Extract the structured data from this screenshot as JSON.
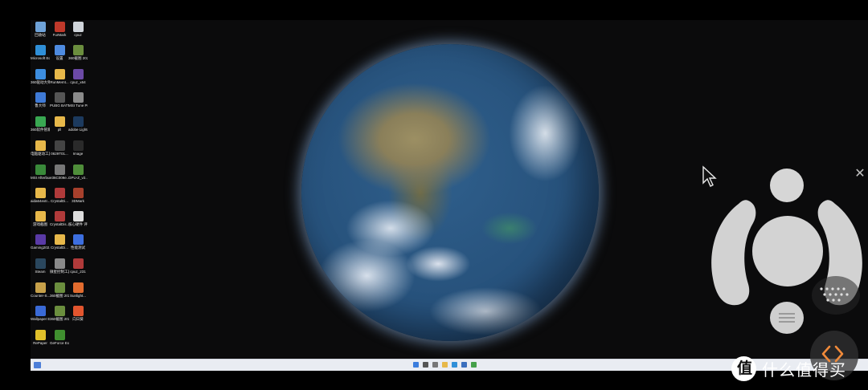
{
  "desktop": {
    "icons": [
      {
        "label": "回收站",
        "color": "#6fa3d9",
        "icon": "recycle-bin-icon"
      },
      {
        "label": "FurMark",
        "color": "#c0392b",
        "icon": "furmark-icon"
      },
      {
        "label": "cpuz",
        "color": "#cfd4da",
        "icon": "file-icon"
      },
      {
        "label": "Microsoft Edge",
        "color": "#2f8fd8",
        "icon": "edge-icon"
      },
      {
        "label": "设置",
        "color": "#4e8be0",
        "icon": "settings-app-icon"
      },
      {
        "label": "360截图 20220412...",
        "color": "#6b8e3e",
        "icon": "image-icon"
      },
      {
        "label": "360驱动大师",
        "color": "#3d8ee0",
        "icon": "driver-master-icon"
      },
      {
        "label": "RunMemt...",
        "color": "#e7b84a",
        "icon": "folder-icon"
      },
      {
        "label": "cpuz_x64",
        "color": "#6c4aa6",
        "icon": "cpuz-icon"
      },
      {
        "label": "鲁大师",
        "color": "#3f7ad6",
        "icon": "ludashi-icon"
      },
      {
        "label": "PUBG BATTLEGR...",
        "color": "#555",
        "icon": "pubg-icon"
      },
      {
        "label": "MSI Tune Pro",
        "color": "#8a8a8a",
        "icon": "msi-icon"
      },
      {
        "label": "360软件管家",
        "color": "#39a852",
        "icon": "software-manager-icon"
      },
      {
        "label": "pll",
        "color": "#e7b84a",
        "icon": "folder-icon"
      },
      {
        "label": "adobe Lightroo...",
        "color": "#1c3a5e",
        "icon": "lightroom-icon"
      },
      {
        "label": "电脑驱动工具2021",
        "color": "#e7b84a",
        "icon": "folder-icon"
      },
      {
        "label": "0629T01...",
        "color": "#444",
        "icon": "image-icon"
      },
      {
        "label": "Image",
        "color": "#2a2a2a",
        "icon": "image-icon"
      },
      {
        "label": "MSI Afterburner",
        "color": "#3a8a3a",
        "icon": "afterburner-icon"
      },
      {
        "label": "e36C009e...",
        "color": "#777",
        "icon": "file-icon"
      },
      {
        "label": "GPU-Z_v2...",
        "color": "#4f8e3a",
        "icon": "gpuz-icon"
      },
      {
        "label": "aida64extr...",
        "color": "#e7b84a",
        "icon": "folder-icon"
      },
      {
        "label": "CrystalDi...",
        "color": "#b03a3a",
        "icon": "winrar-icon"
      },
      {
        "label": "3DMark",
        "color": "#a7402c",
        "icon": "3dmark-icon"
      },
      {
        "label": "游戏截图",
        "color": "#e7b84a",
        "icon": "folder-icon"
      },
      {
        "label": "CrystalDis...",
        "color": "#b03a3a",
        "icon": "winrar-icon"
      },
      {
        "label": "核心硬件 评测",
        "color": "#dddddd",
        "icon": "file-icon"
      },
      {
        "label": "Gaming202...",
        "color": "#5a3aa6",
        "icon": "gaming-icon"
      },
      {
        "label": "CrystalDi...",
        "color": "#e7b84a",
        "icon": "folder-icon"
      },
      {
        "label": "性能测试",
        "color": "#3d6fe0",
        "icon": "benchmark-icon"
      },
      {
        "label": "Steam",
        "color": "#2a475e",
        "icon": "steam-icon"
      },
      {
        "label": "微星控制工具 MSI Tune...",
        "color": "#8a8a8a",
        "icon": "msi-icon"
      },
      {
        "label": "cpuz_231",
        "color": "#b03a3a",
        "icon": "winrar-icon"
      },
      {
        "label": "Counter-S... Global Off...",
        "color": "#c7a14a",
        "icon": "csgo-icon"
      },
      {
        "label": "360截图 20220412...",
        "color": "#6b8e3e",
        "icon": "image-icon"
      },
      {
        "label": "Sunlight...",
        "color": "#e26b2e",
        "icon": "sunlight-icon"
      },
      {
        "label": "Wallpaper Engine:...",
        "color": "#3a6ad6",
        "icon": "wallpaper-engine-icon"
      },
      {
        "label": "360截图 20220412...",
        "color": "#6b8e3e",
        "icon": "image-icon"
      },
      {
        "label": "向日葵",
        "color": "#e2552e",
        "icon": "sunflower-icon"
      },
      {
        "label": "RePaper",
        "color": "#e0c02a",
        "icon": "repaper-icon"
      },
      {
        "label": "GeForce Experience",
        "color": "#3f8f2f",
        "icon": "geforce-icon"
      }
    ]
  },
  "taskbar": {
    "apps": [
      {
        "name": "start-icon",
        "color": "#3b7ddd"
      },
      {
        "name": "search-icon",
        "color": "#555555"
      },
      {
        "name": "task-view-icon",
        "color": "#777777"
      },
      {
        "name": "file-explorer-icon",
        "color": "#e7b84a"
      },
      {
        "name": "edge-icon",
        "color": "#2f8fd8"
      },
      {
        "name": "store-icon",
        "color": "#3b6fbd"
      },
      {
        "name": "360-icon",
        "color": "#45a04a"
      }
    ]
  },
  "overlay": {
    "watermark_logo": "值",
    "watermark_text": "什么值得买"
  }
}
